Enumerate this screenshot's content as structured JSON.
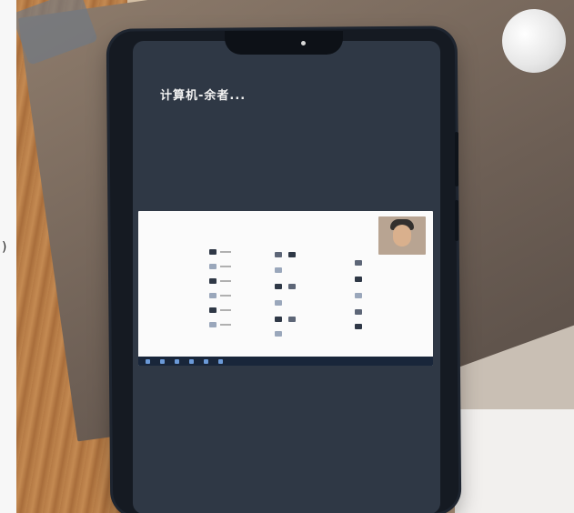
{
  "screen": {
    "title": "计算机-余者..."
  },
  "left_glyph": ")"
}
